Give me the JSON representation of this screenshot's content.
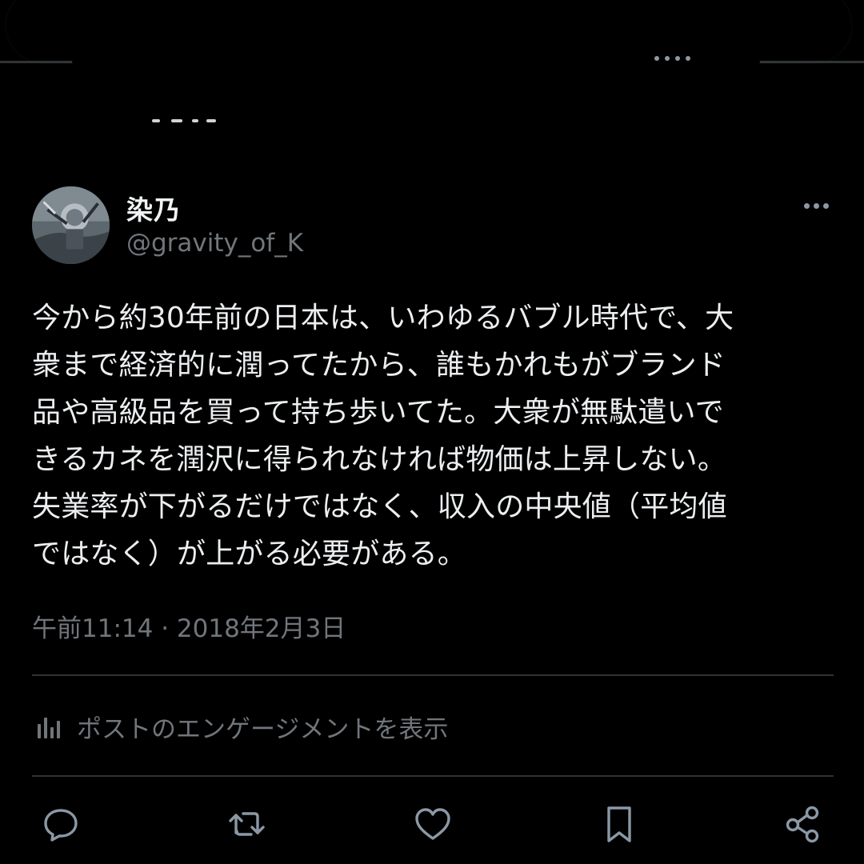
{
  "tweet": {
    "display_name": "染乃",
    "handle": "@gravity_of_K",
    "text_lines": [
      "今から約30年前の日本は、いわゆるバブル時代で、大",
      "衆まで経済的に潤ってたから、誰もかれもがブランド",
      "品や高級品を買って持ち歩いてた。大衆が無駄遣いで",
      "きるカネを潤沢に得られなければ物価は上昇しない。",
      "失業率が下がるだけではなく、収入の中央値（平均値",
      "ではなく）が上がる必要がある。"
    ],
    "timestamp": "午前11:14 · 2018年2月3日"
  },
  "engagement": {
    "label": "ポストのエンゲージメントを表示",
    "icon": "bar-chart-icon"
  },
  "actions": [
    {
      "icon": "reply-icon"
    },
    {
      "icon": "repost-icon"
    },
    {
      "icon": "like-icon"
    },
    {
      "icon": "bookmark-icon"
    },
    {
      "icon": "share-icon"
    }
  ],
  "colors": {
    "background": "#000000",
    "primary_text": "#e7e9ea",
    "secondary_text": "#71767b",
    "divider": "#2f3336"
  }
}
